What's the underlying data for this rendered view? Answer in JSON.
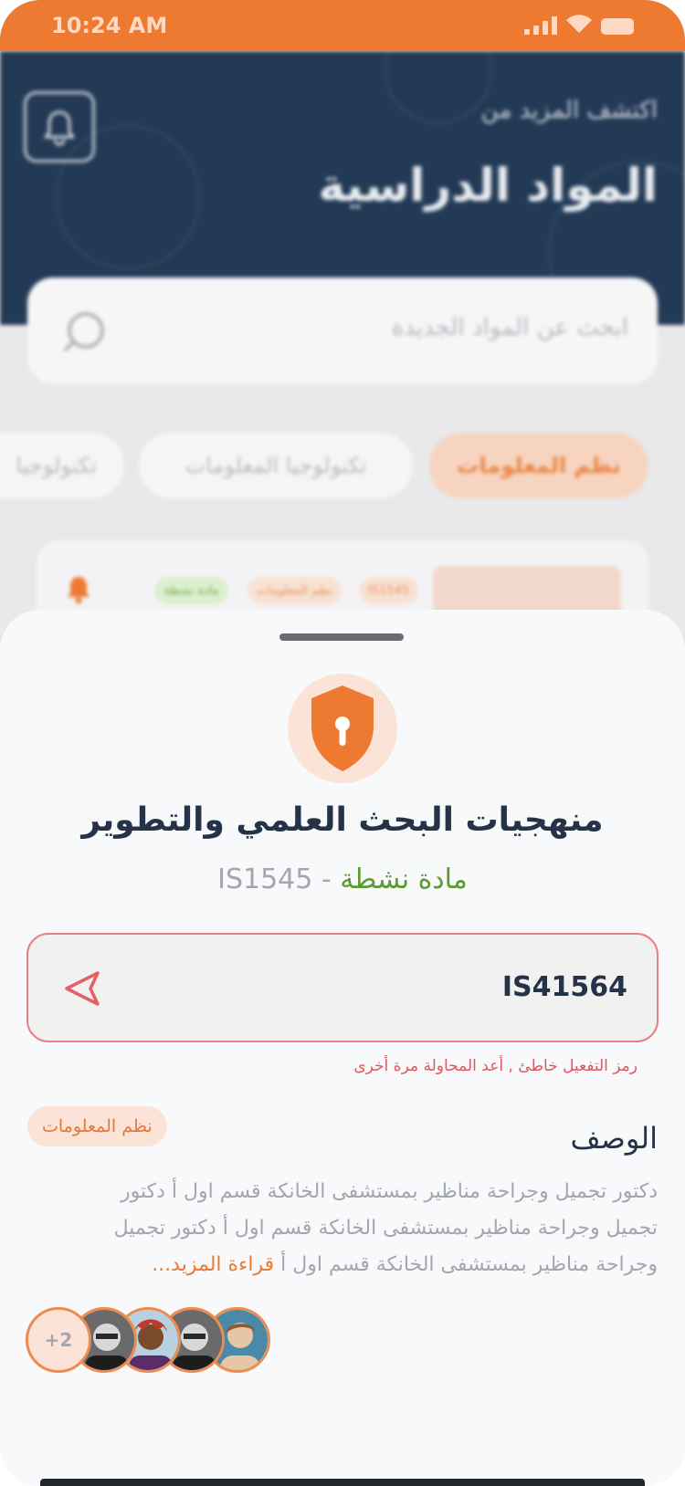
{
  "status_bar": {
    "time": "10:24 AM"
  },
  "header": {
    "subtitle": "اكتشف المزيد من",
    "title": "المواد الدراسية"
  },
  "search": {
    "placeholder": "ابحث عن المواد الجديدة"
  },
  "categories": [
    {
      "label": "نظم المعلومات",
      "active": true
    },
    {
      "label": "تكنولوجيا المعلومات",
      "active": false
    },
    {
      "label": "تكنولوجيا",
      "active": false
    }
  ],
  "background_card": {
    "tags": [
      "IS1545",
      "نظم المعلومات",
      "مادة نشطة"
    ]
  },
  "sheet": {
    "course_title": "منهجيات البحث العلمي والتطوير",
    "status_text": "مادة نشطة",
    "separator": " - ",
    "course_code": "IS1545",
    "activation_code_value": "IS41564",
    "error_message": "رمز التفعيل خاطئ , أعد المحاولة مرة أخرى",
    "description_heading": "الوصف",
    "category_tag": "نظم المعلومات",
    "description_text": "دكتور تجميل وجراحة مناظير بمستشفى الخانكة قسم اول أ دكتور تجميل وجراحة مناظير بمستشفى الخانكة قسم اول أ دكتور تجميل وجراحة مناظير بمستشفى الخانكة قسم اول أ",
    "read_more": "قراءة المزيد...",
    "avatars_more": "+2"
  },
  "colors": {
    "accent": "#ee7931",
    "header_bg": "#233a56",
    "title_text": "#243347",
    "active_status": "#5b9c31",
    "error": "#e0565d"
  },
  "icons": {
    "header": "bell-icon",
    "search": "search-icon",
    "lock": "shield-lock-icon",
    "send": "send-icon"
  }
}
